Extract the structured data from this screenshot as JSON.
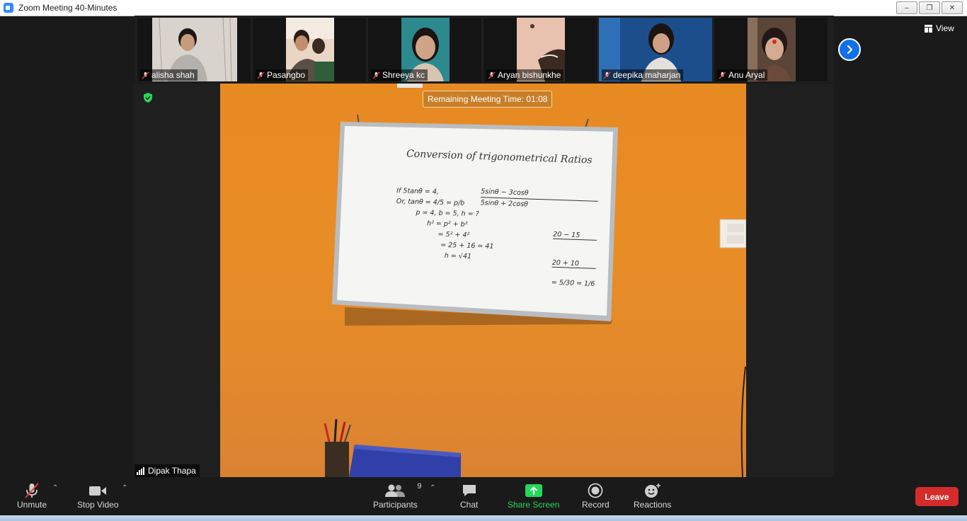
{
  "window": {
    "title": "Zoom Meeting 40-Minutes"
  },
  "gallery": {
    "participants": [
      {
        "name": "alisha shah"
      },
      {
        "name": "Pasangbo"
      },
      {
        "name": "Shreeya kc"
      },
      {
        "name": "Aryan bishunkhe"
      },
      {
        "name": "deepika maharjan"
      },
      {
        "name": "Anu Aryal"
      }
    ],
    "view_label": "View"
  },
  "meeting": {
    "remaining_time": "Remaining Meeting Time: 01:08",
    "active_speaker": "Dipak Thapa"
  },
  "whiteboard": {
    "heading": "Conversion of trigonometrical Ratios",
    "given_lines": [
      "If 5tanθ = 4,",
      "Or, tanθ = 4/5 = p/b",
      "p = 4, b = 5, h = ?",
      "h² = p² + b²",
      "= 5² + 4²",
      "= 25 + 16 = 41",
      "h = √41"
    ],
    "solution_lines": [
      "5sinθ − 3cosθ",
      "5sinθ + 2cosθ",
      "20 − 15",
      "20 + 10",
      "= 5/30 = 1/6"
    ]
  },
  "toolbar": {
    "unmute": "Unmute",
    "stop_video": "Stop Video",
    "participants": "Participants",
    "participants_count": "9",
    "chat": "Chat",
    "share_screen": "Share Screen",
    "record": "Record",
    "reactions": "Reactions",
    "leave": "Leave"
  },
  "colors": {
    "share_green": "#23d959",
    "leave_red": "#d42b2b",
    "accent_blue": "#0e71eb",
    "wall_orange": "#e78a22"
  }
}
